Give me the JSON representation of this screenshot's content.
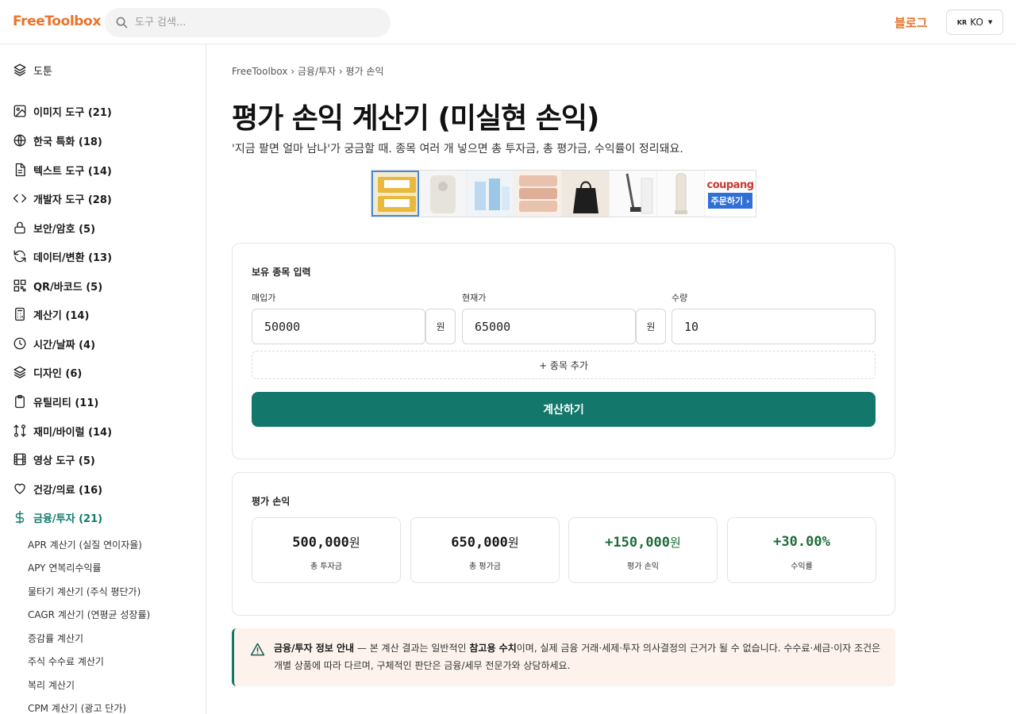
{
  "header": {
    "logo": "FreeToolbox",
    "search_placeholder": "도구 검색...",
    "blog": "블로그",
    "lang_flag": "KR",
    "lang": "KO"
  },
  "sidebar": {
    "items": [
      {
        "label": "도툰",
        "icon": "layers-icon"
      },
      {
        "label": "이미지 도구 (21)",
        "icon": "image-icon"
      },
      {
        "label": "한국 특화 (18)",
        "icon": "globe-icon"
      },
      {
        "label": "텍스트 도구 (14)",
        "icon": "document-icon"
      },
      {
        "label": "개발자 도구 (28)",
        "icon": "code-icon"
      },
      {
        "label": "보안/암호 (5)",
        "icon": "lock-icon"
      },
      {
        "label": "데이터/변환 (13)",
        "icon": "refresh-icon"
      },
      {
        "label": "QR/바코드 (5)",
        "icon": "qr-icon"
      },
      {
        "label": "계산기 (14)",
        "icon": "calculator-icon"
      },
      {
        "label": "시간/날짜 (4)",
        "icon": "clock-icon"
      },
      {
        "label": "디자인 (6)",
        "icon": "layers-icon"
      },
      {
        "label": "유틸리티 (11)",
        "icon": "clipboard-icon"
      },
      {
        "label": "재미/바이럴 (14)",
        "icon": "music-icon"
      },
      {
        "label": "영상 도구 (5)",
        "icon": "film-icon"
      },
      {
        "label": "건강/의료 (16)",
        "icon": "heart-icon"
      },
      {
        "label": "금융/투자 (21)",
        "icon": "dollar-icon"
      }
    ],
    "sub_items": [
      "APR 계산기 (실질 연이자율)",
      "APY 연복리수익률",
      "물타기 계산기 (주식 평단가)",
      "CAGR 계산기 (연평균 성장률)",
      "증감률 계산기",
      "주식 수수료 계산기",
      "복리 계산기",
      "CPM 계산기 (광고 단가)"
    ]
  },
  "main": {
    "breadcrumb": "FreeToolbox › 금융/투자 › 평가 손익",
    "title": "평가 손익 계산기 (미실현 손익)",
    "subtitle": "'지금 팔면 얼마 남나'가 궁금할 때. 종목 여러 개 넣으면 총 투자금, 총 평가금, 수익률이 정리돼요.",
    "ad": {
      "brand": "coupang",
      "button": "주문하기 ›"
    },
    "input_card": {
      "title": "보유 종목 입력",
      "buy_label": "매입가",
      "buy_value": "50000",
      "unit": "원",
      "current_label": "현재가",
      "current_value": "65000",
      "qty_label": "수량",
      "qty_value": "10",
      "add_row": "+ 종목 추가",
      "calc_button": "계산하기"
    },
    "result_card": {
      "title": "평가 손익",
      "stats": [
        {
          "value": "500,000",
          "unit": "원",
          "label": "총 투자금"
        },
        {
          "value": "650,000",
          "unit": "원",
          "label": "총 평가금"
        },
        {
          "value": "+150,000",
          "unit": "원",
          "label": "평가 손익"
        },
        {
          "value": "+30.00%",
          "unit": "",
          "label": "수익률"
        }
      ]
    },
    "notice": {
      "title": "금융/투자 정보 안내",
      "text1": " — 본 계산 결과는 일반적인 ",
      "bold": "참고용 수치",
      "text2": "이며, 실제 금융 거래·세제·투자 의사결정의 근거가 될 수 없습니다. 수수료·세금·이자 조건은 개별 상품에 따라 다르며, 구체적인 판단은 금융/세무 전문가와 상담하세요."
    }
  },
  "colors": {
    "brand": "#e8742c",
    "accent": "#13776b",
    "positive": "#1e6b3a"
  }
}
